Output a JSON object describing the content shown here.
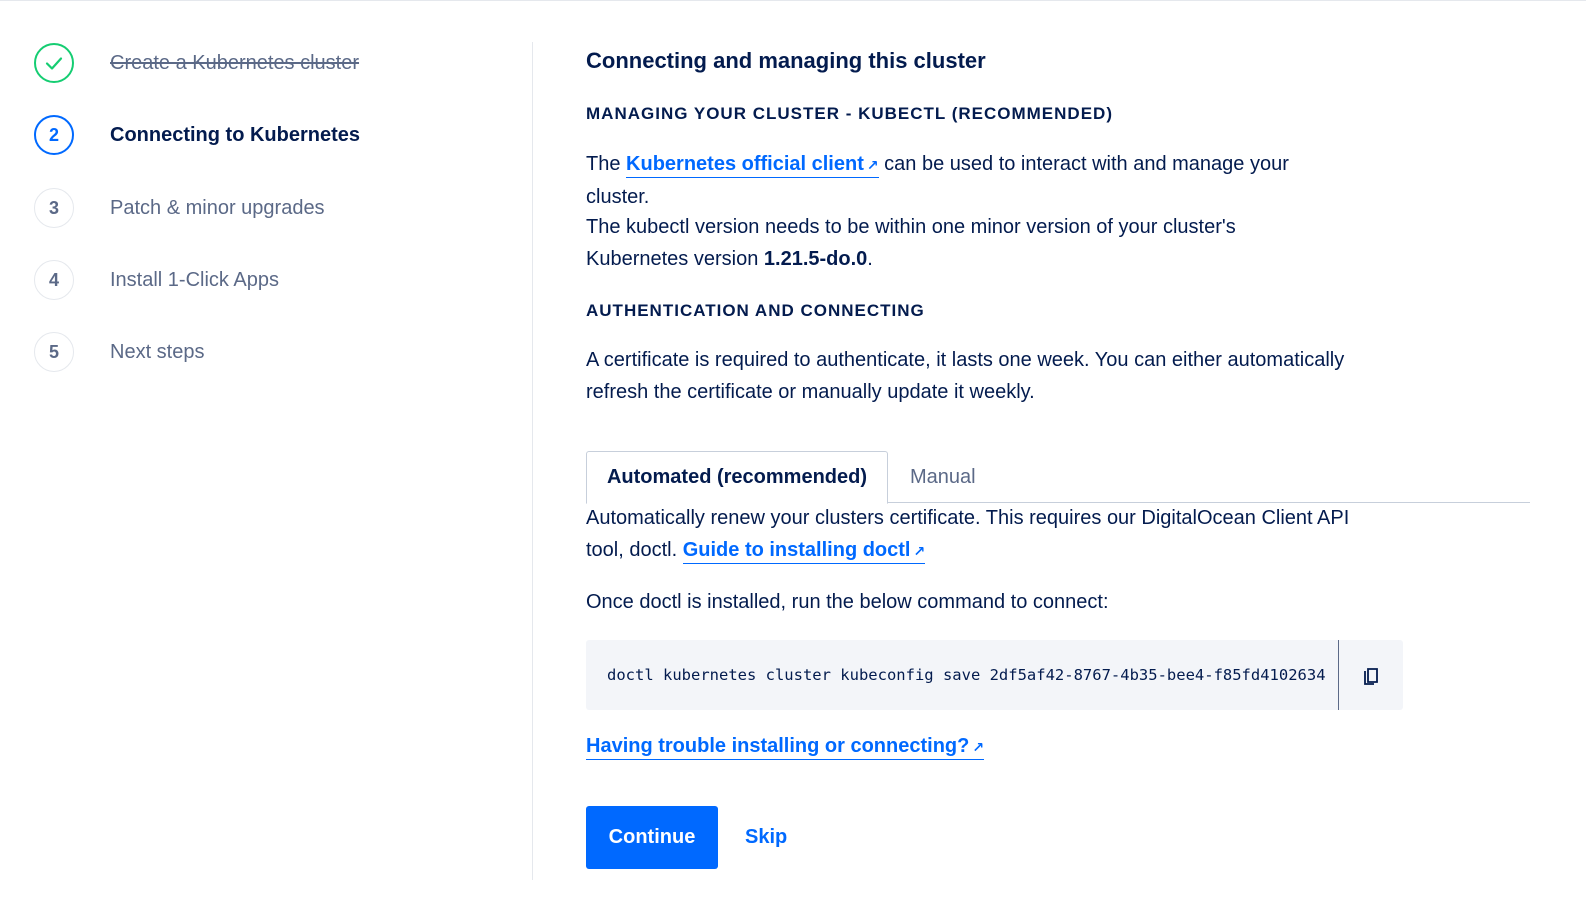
{
  "steps": [
    {
      "number": "",
      "label": "Create a Kubernetes cluster",
      "state": "done"
    },
    {
      "number": "2",
      "label": "Connecting to Kubernetes",
      "state": "active"
    },
    {
      "number": "3",
      "label": "Patch & minor upgrades",
      "state": "pending"
    },
    {
      "number": "4",
      "label": "Install 1-Click Apps",
      "state": "pending"
    },
    {
      "number": "5",
      "label": "Next steps",
      "state": "pending"
    }
  ],
  "main": {
    "title": "Connecting and managing this cluster",
    "managing_heading": "MANAGING YOUR CLUSTER - KUBECTL (RECOMMENDED)",
    "managing_text": {
      "pre": "The ",
      "link": "Kubernetes official client",
      "post": " can be used to interact with and manage your cluster.",
      "line2_pre": "The kubectl version needs to be within one minor version of your cluster's Kubernetes version ",
      "version": "1.21.5-do.0",
      "line2_post": "."
    },
    "auth_heading": "AUTHENTICATION AND CONNECTING",
    "auth_text": "A certificate is required to authenticate, it lasts one week. You can either automatically refresh the certificate or manually update it weekly.",
    "tabs": [
      {
        "label": "Automated (recommended)",
        "active": true
      },
      {
        "label": "Manual",
        "active": false
      }
    ],
    "automated_text": {
      "pre": "Automatically renew your clusters certificate. This requires our DigitalOcean Client API tool, doctl. ",
      "link": "Guide to installing doctl"
    },
    "run_text": "Once doctl is installed, run the below command to connect:",
    "command": "doctl kubernetes cluster kubeconfig save 2df5af42-8767-4b35-bee4-f85fd4102634",
    "trouble_link": "Having trouble installing or connecting?",
    "continue_label": "Continue",
    "skip_label": "Skip",
    "external_arrow": "↗"
  },
  "colors": {
    "primary": "#0069ff",
    "text": "#031b4e",
    "muted": "#5b6987",
    "success": "#15cd72",
    "code_bg": "#f3f5f9"
  },
  "icons": {
    "done_step": "checkmark-icon",
    "copy": "copy-icon",
    "external": "external-link-icon"
  }
}
